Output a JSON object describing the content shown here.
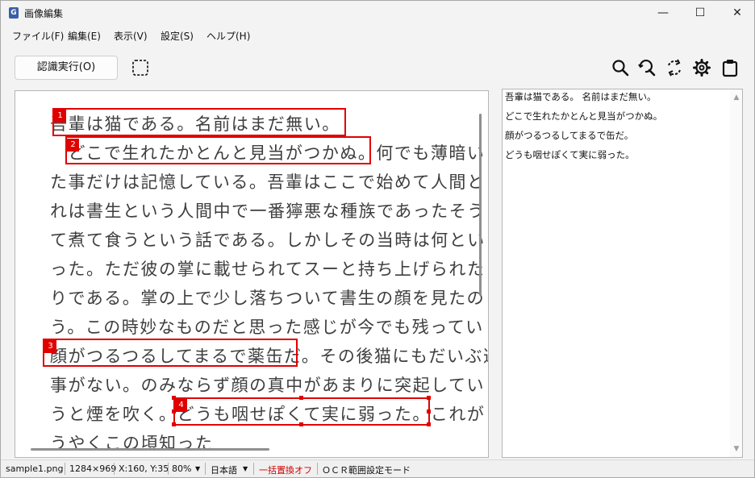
{
  "window": {
    "title": "画像編集",
    "app_icon": "G",
    "minimize": "—",
    "maximize": "☐",
    "close": "✕"
  },
  "menu": [
    "ファイル(F)",
    "編集(E)",
    "表示(V)",
    "設定(S)",
    "ヘルプ(H)"
  ],
  "toolbar": {
    "ocr_button": "認識実行(O)",
    "icons": [
      "selection-tool-icon",
      "search-icon",
      "search-refresh-icon",
      "rotate-icon",
      "gear-icon",
      "clipboard-icon"
    ]
  },
  "document": {
    "lines": [
      "吾輩は猫である。名前はまだ無い。",
      "　どこで生れたかとんと見当がつかぬ。何でも薄暗い",
      "た事だけは記憶している。吾輩はここで始めて人間と",
      "れは書生という人間中で一番獰悪な種族であったそう",
      "て煮て食うという話である。しかしその当時は何とい",
      "った。ただ彼の掌に載せられてスーと持ち上げられた",
      "りである。掌の上で少し落ちついて書生の顔を見たの",
      "う。この時妙なものだと思った感じが今でも残ってい",
      "顔がつるつるしてまるで薬缶だ。その後猫にもだいぶ逢",
      "事がない。のみならず顔の真中があまりに突起してい",
      "うと煙を吹く。どうも咽せぽくて実に弱った。これが",
      "うやくこの頃知った"
    ],
    "regions": [
      {
        "number": "1"
      },
      {
        "number": "2"
      },
      {
        "number": "3"
      },
      {
        "number": "4"
      }
    ]
  },
  "recognized_text": [
    "吾輩は猫である。 名前はまだ無い。",
    "どこで生れたかとんと見当がつかぬ。",
    "顔がつるつるしてまるで缶だ。",
    "どうも咽せぽくて実に弱った。"
  ],
  "status": {
    "file": "sample1.png",
    "size": "1284×969",
    "coords": "X:160, Y:35",
    "zoom": "80%",
    "language": "日本語",
    "replace": "一括置換オフ",
    "mode": "ＯＣＲ範囲設定モード"
  },
  "colors": {
    "accent_red": "#e00000",
    "replace_off": "#d00000"
  }
}
